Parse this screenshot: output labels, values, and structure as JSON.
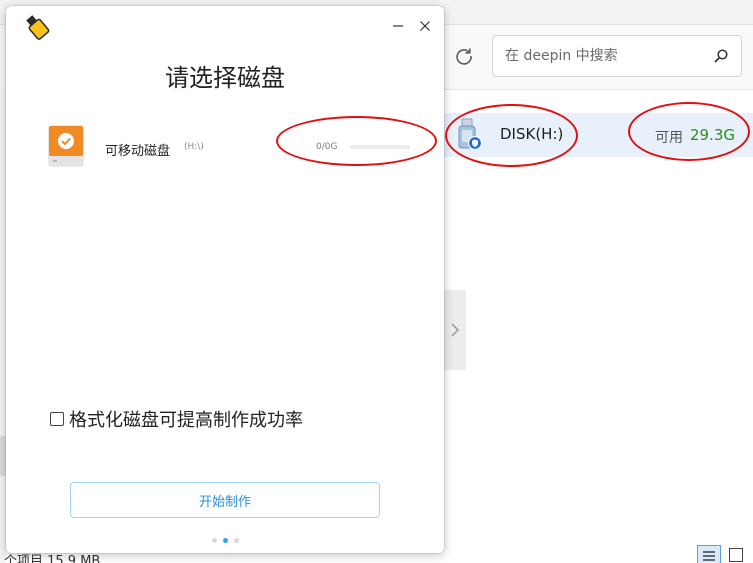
{
  "explorer": {
    "search": {
      "placeholder": "在 deepin 中搜索"
    },
    "drive": {
      "name": "DISK(H:)",
      "free_label": "可用",
      "free_value": "29.3G"
    },
    "status": {
      "text": "个项目 15.9 MB"
    }
  },
  "dialog": {
    "title": "请选择磁盘",
    "disk": {
      "name": "可移动磁盘",
      "path": "(H:\\)",
      "capacity": "0/0G",
      "usage_fraction": 0
    },
    "format_option": {
      "label": "格式化磁盘可提高制作成功率",
      "checked": false
    },
    "start_button": {
      "label": "开始制作"
    },
    "pagination": {
      "total": 3,
      "current": 2
    }
  },
  "colors": {
    "accent": "#2ca7f8",
    "free_space": "#2e8b1e",
    "annotation": "#e01010",
    "selected_row": "#e8f1fb"
  },
  "icons": {
    "app_logo": "usb-stick-logo-icon",
    "drive": "usb-drive-icon",
    "disk": "removable-disk-check-icon",
    "refresh": "refresh-icon",
    "search": "search-icon",
    "minimize": "minimize-icon",
    "close": "close-icon"
  }
}
